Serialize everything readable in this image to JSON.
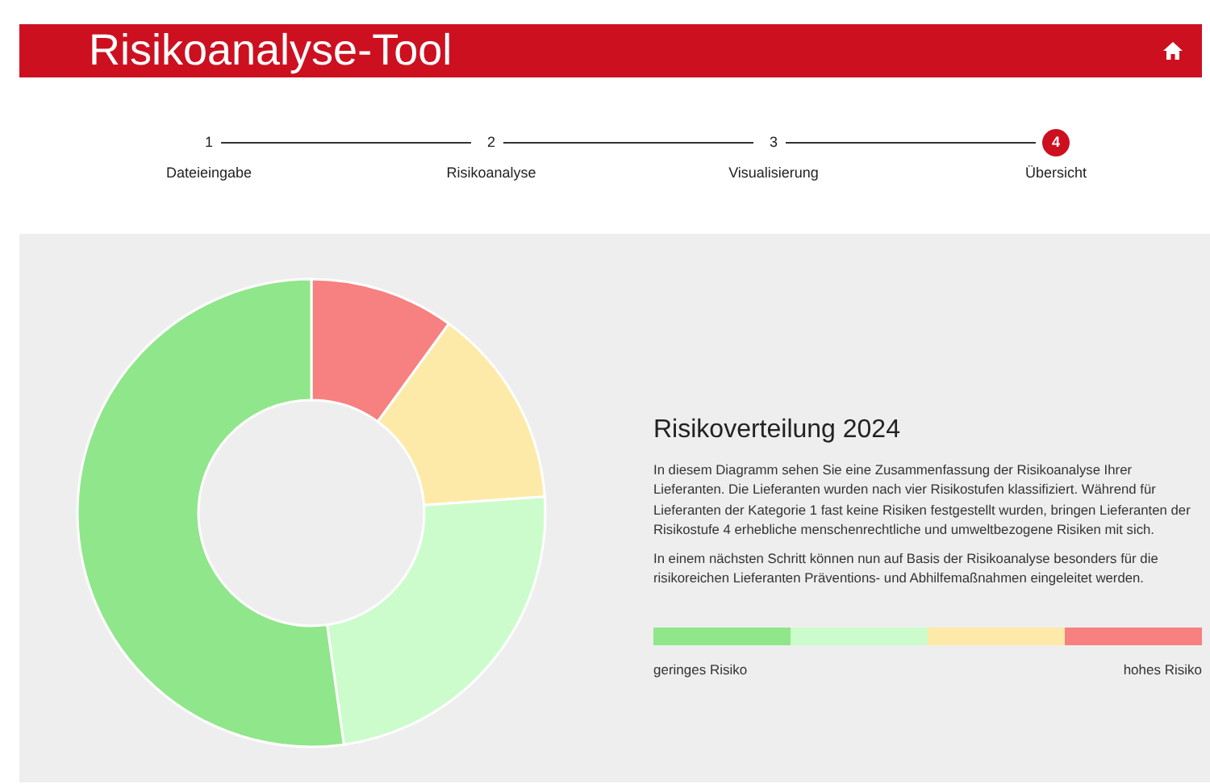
{
  "header": {
    "title": "Risikoanalyse-Tool"
  },
  "steps": [
    {
      "number": "1",
      "label": "Dateieingabe",
      "selected": false
    },
    {
      "number": "2",
      "label": "Risikoanalyse",
      "selected": false
    },
    {
      "number": "3",
      "label": "Visualisierung",
      "selected": false
    },
    {
      "number": "4",
      "label": "Übersicht",
      "selected": true
    }
  ],
  "summary": {
    "title": "Risikoverteilung 2024",
    "paragraphs": [
      "In diesem Diagramm sehen Sie eine Zusammenfassung der Risikoanalyse Ihrer Lieferanten. Die Lieferanten wurden nach vier Risikostufen klassifiziert. Während für Lieferanten der Kategorie 1 fast keine Risiken festgestellt wurden, bringen Lieferanten der Risikostufe 4 erhebliche menschenrechtliche und umweltbezogene Risiken mit sich.",
      "In einem nächsten Schritt können nun auf Basis der Risikoanalyse besonders für die risikoreichen Lieferanten Präventions- und Abhilfemaßnahmen eingeleitet werden."
    ],
    "legend": {
      "colors": [
        {
          "color": "#90e68a"
        },
        {
          "color": "#ccfccc"
        },
        {
          "color": "#feeaa8"
        },
        {
          "color": "#f78080"
        }
      ],
      "low_label": "geringes Risiko",
      "high_label": "hohes Risiko"
    }
  }
}
